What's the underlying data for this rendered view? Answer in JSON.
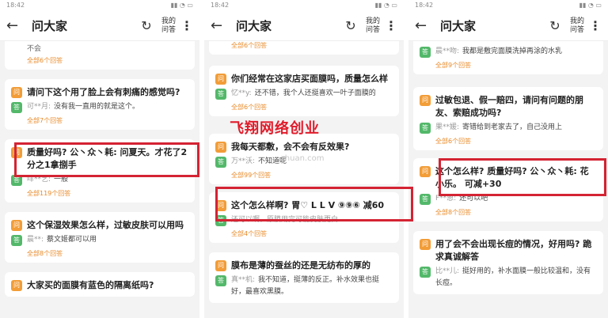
{
  "status_time": "18:42",
  "title": "问大家",
  "my_questions": "我的\n问答",
  "badge_q": "问",
  "badge_a": "答",
  "watermark": "飞翔网络创业",
  "watermark_url": "...zhuan.com",
  "panel1": {
    "top_answer": "不会",
    "top_count": "全部6个回答",
    "cards": [
      {
        "q": "请问下这个用了脸上会有刺痛的感觉吗?",
        "user": "可**月:",
        "a": "没有我一直用的就是这个。",
        "count": "全部7个回答"
      },
      {
        "q": "质量好吗? 公丶众丶耗: 问夏天。才花了2分之1拿捌手",
        "user": "咩**艺:",
        "a": "一般",
        "count": "全部119个回答"
      },
      {
        "q": "这个保湿效果怎么样，过敏皮肤可以用吗",
        "user": "晨**:",
        "a": "蔡文姬都可以用",
        "count": "全部8个回答"
      },
      {
        "q": "大家买的面膜有蓝色的隔离纸吗?",
        "user": "",
        "a": "",
        "count": ""
      }
    ]
  },
  "panel2": {
    "top_count": "全部6个回答",
    "cards": [
      {
        "q": "你们经常在这家店买面膜吗，质量怎么样",
        "user": "忆**y:",
        "a": "还不错，我个人还挺喜欢一叶子面膜的",
        "count": "全部6个回答"
      },
      {
        "q": "我每天都敷，会不会有反效果?",
        "user": "万**沃:",
        "a": "不知道呢",
        "count": "全部99个回答"
      },
      {
        "q": "这个怎么样啊? 胃♡ L L V ⑨⑨⑥ 减60",
        "user": "",
        "a": "还可以啊，原膜用完可能皮肤更白",
        "count": "全部4个回答"
      },
      {
        "q": "膜布是薄的蚕丝的还是无纺布的厚的",
        "user": "真**机:",
        "a": "我不知道，挺薄的反正。补水效果也挺好，最喜欢黑膜。",
        "count": ""
      }
    ]
  },
  "panel3": {
    "top_answer": "我都是敷完面膜洗掉再涂的水乳",
    "top_user": "晨**吻:",
    "top_count": "全部9个回答",
    "cards": [
      {
        "q": "过敏包退、假一赔四，请问有问题的朋友、索赔成功吗?",
        "user": "果**媛:",
        "a": "寄错给到老家去了，自己没用上",
        "count": "全部6个回答"
      },
      {
        "q": "这个怎么样? 质量好吗? 公丶众丶耗: 花小乐。 可减+30",
        "user": "F**恩:",
        "a": "还可以吧",
        "count": "全部8个回答"
      },
      {
        "q": "用了会不会出现长痘的情况，好用吗? 跪求真诚解答",
        "user": "比**儿:",
        "a": "挺好用的，补水面膜一般比较温和，没有长痘。",
        "count": ""
      }
    ]
  }
}
